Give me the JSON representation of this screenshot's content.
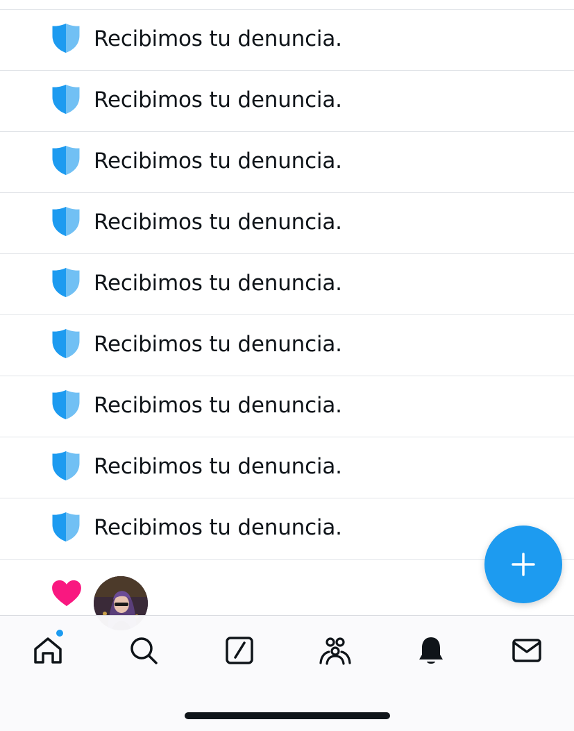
{
  "colors": {
    "accent": "#1d9bf0",
    "shield_light": "#71c0f4",
    "heart": "#f91880",
    "text": "#0f1419"
  },
  "notifications": [
    {
      "icon": "shield-icon",
      "text": "Recibimos tu denuncia."
    },
    {
      "icon": "shield-icon",
      "text": "Recibimos tu denuncia."
    },
    {
      "icon": "shield-icon",
      "text": "Recibimos tu denuncia."
    },
    {
      "icon": "shield-icon",
      "text": "Recibimos tu denuncia."
    },
    {
      "icon": "shield-icon",
      "text": "Recibimos tu denuncia."
    },
    {
      "icon": "shield-icon",
      "text": "Recibimos tu denuncia."
    },
    {
      "icon": "shield-icon",
      "text": "Recibimos tu denuncia."
    },
    {
      "icon": "shield-icon",
      "text": "Recibimos tu denuncia."
    },
    {
      "icon": "shield-icon",
      "text": "Recibimos tu denuncia."
    }
  ],
  "partial_notification": {
    "icon": "heart-icon",
    "avatar": "user-avatar"
  },
  "fab": {
    "icon": "plus-icon"
  },
  "tabbar": {
    "tabs": [
      {
        "icon": "home-icon",
        "active": true,
        "has_dot": true
      },
      {
        "icon": "search-icon"
      },
      {
        "icon": "grok-icon"
      },
      {
        "icon": "communities-icon"
      },
      {
        "icon": "bell-icon"
      },
      {
        "icon": "mail-icon"
      }
    ]
  }
}
